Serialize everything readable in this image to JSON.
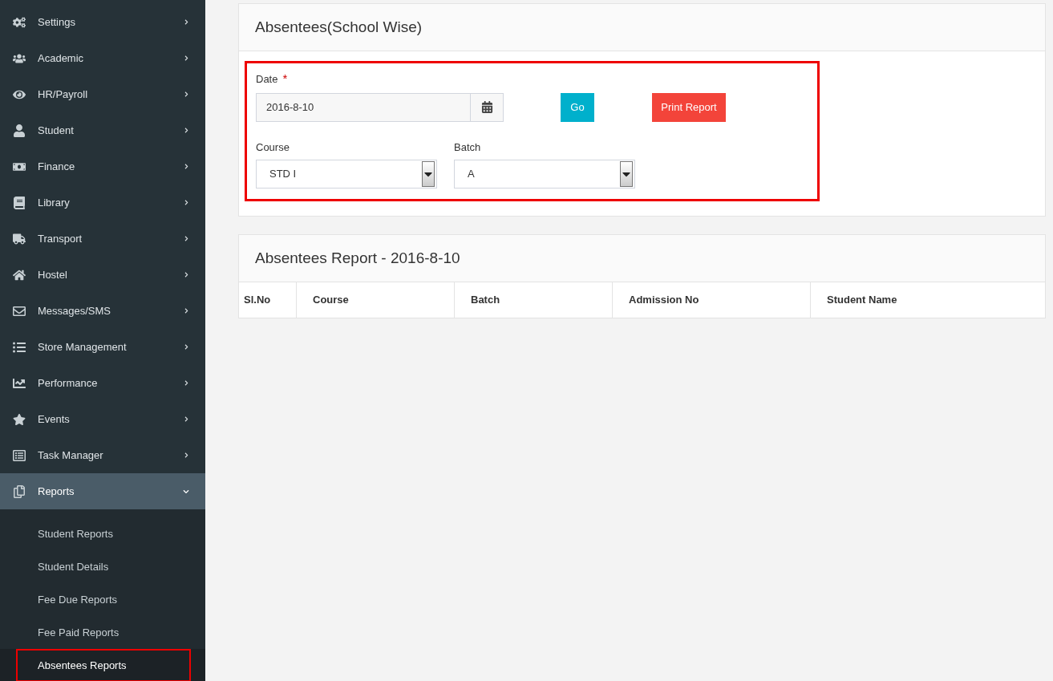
{
  "sidebar": {
    "items": [
      {
        "label": "Settings",
        "expanded": false
      },
      {
        "label": "Academic",
        "expanded": false
      },
      {
        "label": "HR/Payroll",
        "expanded": false
      },
      {
        "label": "Student",
        "expanded": false
      },
      {
        "label": "Finance",
        "expanded": false
      },
      {
        "label": "Library",
        "expanded": false
      },
      {
        "label": "Transport",
        "expanded": false
      },
      {
        "label": "Hostel",
        "expanded": false
      },
      {
        "label": "Messages/SMS",
        "expanded": false
      },
      {
        "label": "Store Management",
        "expanded": false
      },
      {
        "label": "Performance",
        "expanded": false
      },
      {
        "label": "Events",
        "expanded": false
      },
      {
        "label": "Task Manager",
        "expanded": false
      },
      {
        "label": "Reports",
        "expanded": true,
        "children": [
          {
            "label": "Student Reports",
            "selected": false
          },
          {
            "label": "Student Details",
            "selected": false
          },
          {
            "label": "Fee Due Reports",
            "selected": false
          },
          {
            "label": "Fee Paid Reports",
            "selected": false
          },
          {
            "label": "Absentees Reports",
            "selected": true
          }
        ]
      }
    ]
  },
  "form_card": {
    "title": "Absentees(School Wise)",
    "date": {
      "label": "Date",
      "required_mark": "*",
      "value": "2016-8-10"
    },
    "go_button": "Go",
    "print_button": "Print Report",
    "course": {
      "label": "Course",
      "value": "STD I"
    },
    "batch": {
      "label": "Batch",
      "value": "A"
    }
  },
  "report_card": {
    "title": "Absentees Report - 2016-8-10",
    "table": {
      "columns": [
        "Sl.No",
        "Course",
        "Batch",
        "Admission No",
        "Student Name"
      ]
    }
  }
}
